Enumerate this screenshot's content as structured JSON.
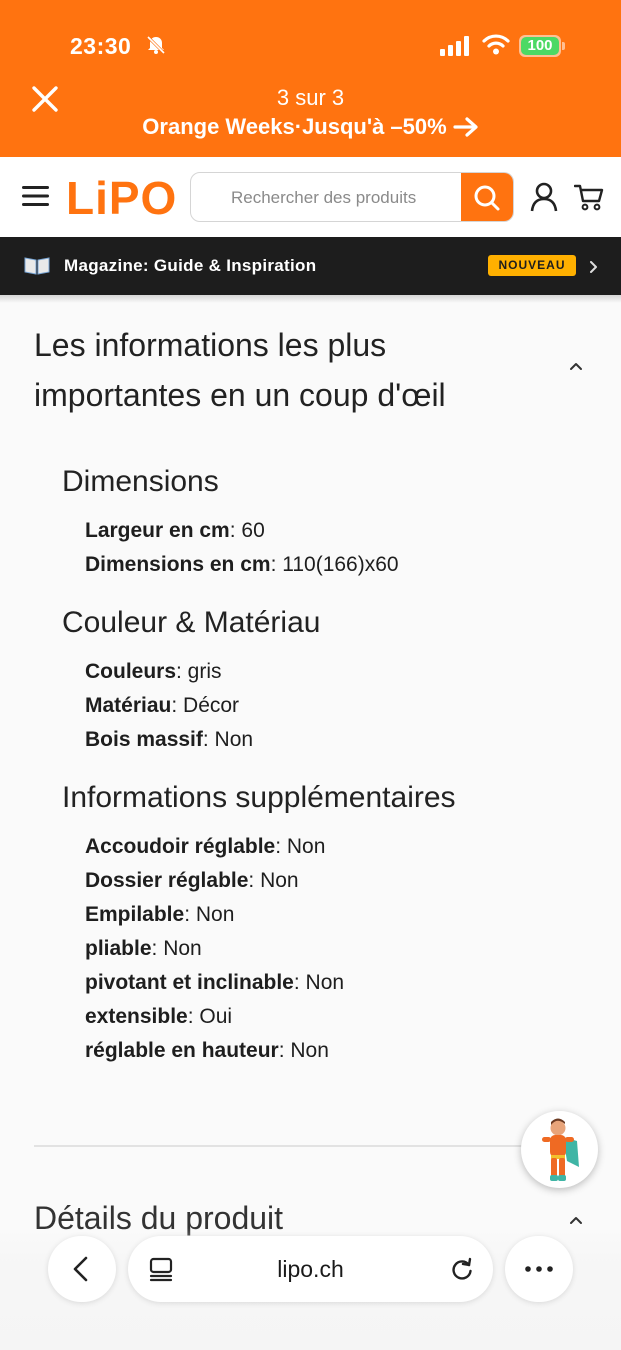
{
  "status_bar": {
    "time": "23:30",
    "battery": "100"
  },
  "promo": {
    "counter": "3 sur 3",
    "text": "Orange Weeks·Jusqu'à –50%"
  },
  "header": {
    "logo": "LiPO",
    "search_placeholder": "Rechercher des produits"
  },
  "magazine": {
    "label": "Magazine: Guide & Inspiration",
    "badge": "NOUVEAU"
  },
  "section": {
    "title_line1": "Les informations les plus",
    "title_line2": "importantes en un coup d'œil"
  },
  "groups": [
    {
      "title": "Dimensions",
      "props": [
        {
          "key": "Largeur en cm",
          "value": ": 60"
        },
        {
          "key": "Dimensions en cm",
          "value": ": 110(166)x60"
        }
      ]
    },
    {
      "title": "Couleur & Matériau",
      "props": [
        {
          "key": "Couleurs",
          "value": ": gris"
        },
        {
          "key": "Matériau",
          "value": ": Décor"
        },
        {
          "key": "Bois massif",
          "value": ": Non"
        }
      ]
    },
    {
      "title": "Informations supplémentaires",
      "props": [
        {
          "key": "Accoudoir réglable",
          "value": ": Non"
        },
        {
          "key": "Dossier réglable",
          "value": ": Non"
        },
        {
          "key": "Empilable",
          "value": ": Non"
        },
        {
          "key": "pliable",
          "value": ": Non"
        },
        {
          "key": "pivotant et inclinable",
          "value": ": Non"
        },
        {
          "key": "extensible",
          "value": ": Oui"
        },
        {
          "key": "réglable en hauteur",
          "value": ": Non"
        }
      ]
    }
  ],
  "details": {
    "title": "Détails du produit"
  },
  "browser": {
    "url": "lipo.ch"
  },
  "colors": {
    "brand_orange": "#ff7310",
    "badge_yellow": "#ffb000",
    "dark_bar": "#1d1d1d"
  },
  "icons": [
    "close-icon",
    "arrow-right-icon",
    "menu-icon",
    "search-icon",
    "user-icon",
    "cart-icon",
    "book-icon",
    "chevron-right-icon",
    "chevron-up-icon",
    "back-icon",
    "tabs-icon",
    "reload-icon",
    "more-icon",
    "bell-muted-icon",
    "signal-icon",
    "wifi-icon",
    "battery-icon"
  ]
}
